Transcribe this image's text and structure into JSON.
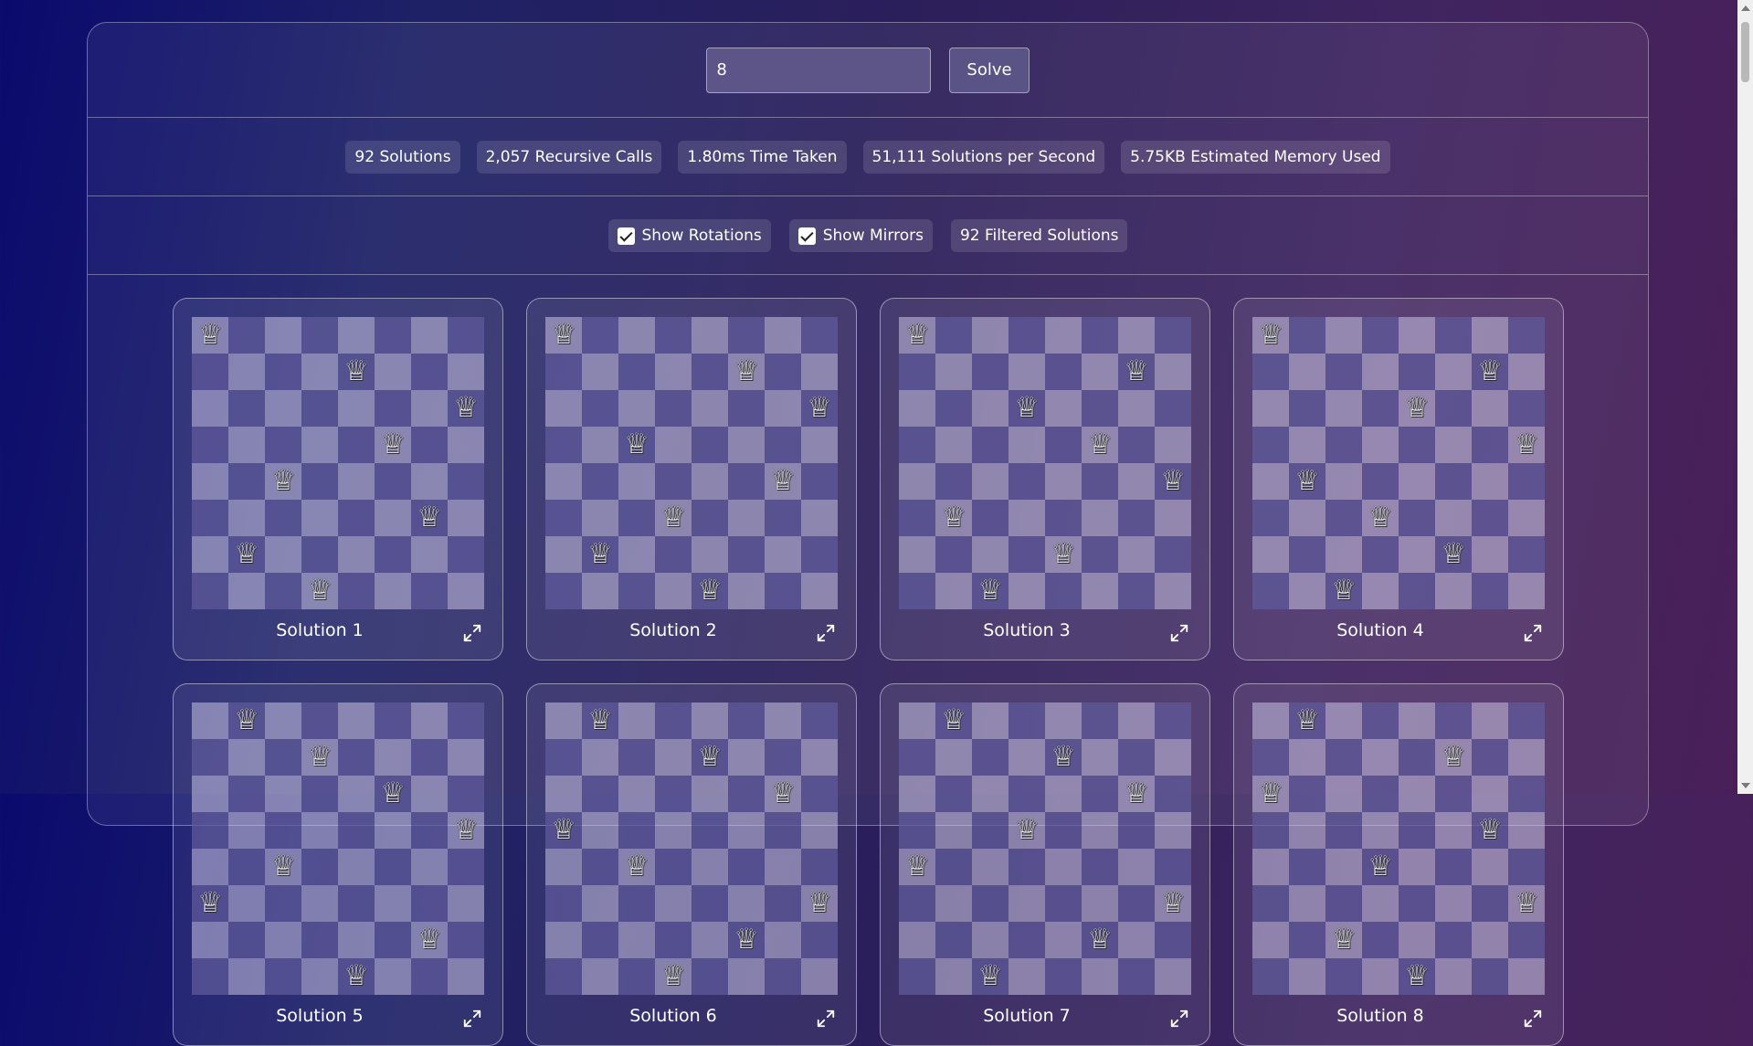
{
  "controls": {
    "n_value": "8",
    "solve_label": "Solve"
  },
  "stats": [
    "92 Solutions",
    "2,057 Recursive Calls",
    "1.80ms Time Taken",
    "51,111 Solutions per Second",
    "5.75KB Estimated Memory Used"
  ],
  "filters": {
    "rotations_label": "Show Rotations",
    "rotations_checked": true,
    "mirrors_label": "Show Mirrors",
    "mirrors_checked": true,
    "filtered_count": "92 Filtered Solutions"
  },
  "board_size": 8,
  "queen_glyph": "♕",
  "solutions": [
    {
      "label": "Solution 1",
      "queens": [
        0,
        4,
        7,
        5,
        2,
        6,
        1,
        3
      ]
    },
    {
      "label": "Solution 2",
      "queens": [
        0,
        5,
        7,
        2,
        6,
        3,
        1,
        4
      ]
    },
    {
      "label": "Solution 3",
      "queens": [
        0,
        6,
        3,
        5,
        7,
        1,
        4,
        2
      ]
    },
    {
      "label": "Solution 4",
      "queens": [
        0,
        6,
        4,
        7,
        1,
        3,
        5,
        2
      ]
    },
    {
      "label": "Solution 5",
      "queens": [
        1,
        3,
        5,
        7,
        2,
        0,
        6,
        4
      ]
    },
    {
      "label": "Solution 6",
      "queens": [
        1,
        4,
        6,
        0,
        2,
        7,
        5,
        3
      ]
    },
    {
      "label": "Solution 7",
      "queens": [
        1,
        4,
        6,
        3,
        0,
        7,
        5,
        2
      ]
    },
    {
      "label": "Solution 8",
      "queens": [
        1,
        5,
        0,
        6,
        3,
        7,
        2,
        4
      ]
    }
  ]
}
